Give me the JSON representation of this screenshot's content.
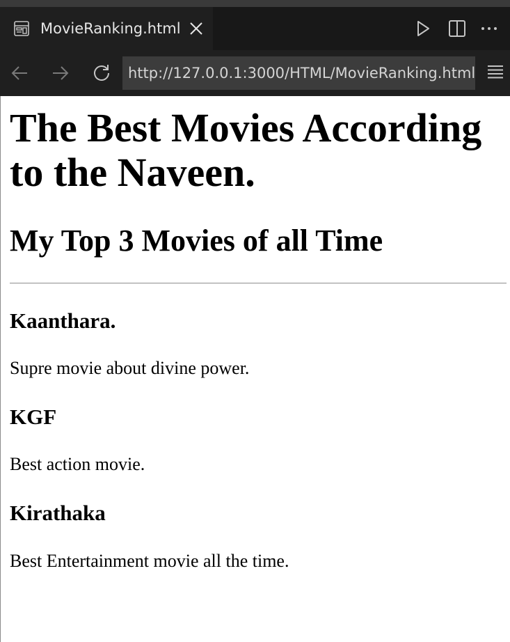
{
  "window": {
    "tab_title": "MovieRanking.html"
  },
  "tab_actions": {
    "run_icon": "play-icon",
    "split_icon": "split-editor-icon",
    "more_icon": "ellipsis-icon"
  },
  "navigation": {
    "url": "http://127.0.0.1:3000/HTML/MovieRanking.html",
    "back_icon": "arrow-left-icon",
    "forward_icon": "arrow-right-icon",
    "reload_icon": "reload-icon",
    "menu_icon": "hamburger-menu-icon"
  },
  "page": {
    "heading": "The Best Movies According to the Naveen.",
    "subheading": "My Top 3 Movies of all Time",
    "movies": [
      {
        "title": "Kaanthara.",
        "description": "Supre movie about divine power."
      },
      {
        "title": "KGF",
        "description": "Best action movie."
      },
      {
        "title": "Kirathaka",
        "description": "Best Entertainment movie all the time."
      }
    ]
  },
  "colors": {
    "chrome_background": "#1f1f1f",
    "tab_strip": "#181818",
    "url_background": "#3c3c3c",
    "icon": "#c5c5c5",
    "page_background": "#ffffff"
  }
}
